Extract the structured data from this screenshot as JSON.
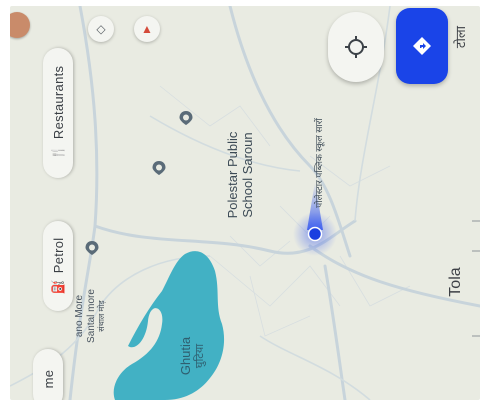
{
  "filters": {
    "restaurants_label": "Restaurants",
    "petrol_label": "Petrol",
    "home_label": "me",
    "restaurants_icon": "fork-knife-icon",
    "petrol_icon": "fuel-pump-icon"
  },
  "places": {
    "school_line1": "Polestar Public",
    "school_line2": "School Saroun",
    "school_hindi": "पोलेस्टार पब्लिक स्कूल सारों",
    "lake_name": "Ghutia",
    "lake_hindi": "घुटिया",
    "left_place_line1": "ano More",
    "left_place_line2": "Santal more",
    "left_place_hindi": "संथाल मोड़",
    "tola_label": "Tola",
    "top_right_label": "टोला"
  },
  "colors": {
    "map_bg": "#e9ebe2",
    "water": "#42b1c4",
    "road": "#c9d6dc",
    "location_blue": "#1a3fe0",
    "nav_button": "#1a44e8"
  },
  "controls": {
    "compass_icon": "compass-icon",
    "navigate_icon": "navigate-diamond-icon"
  }
}
